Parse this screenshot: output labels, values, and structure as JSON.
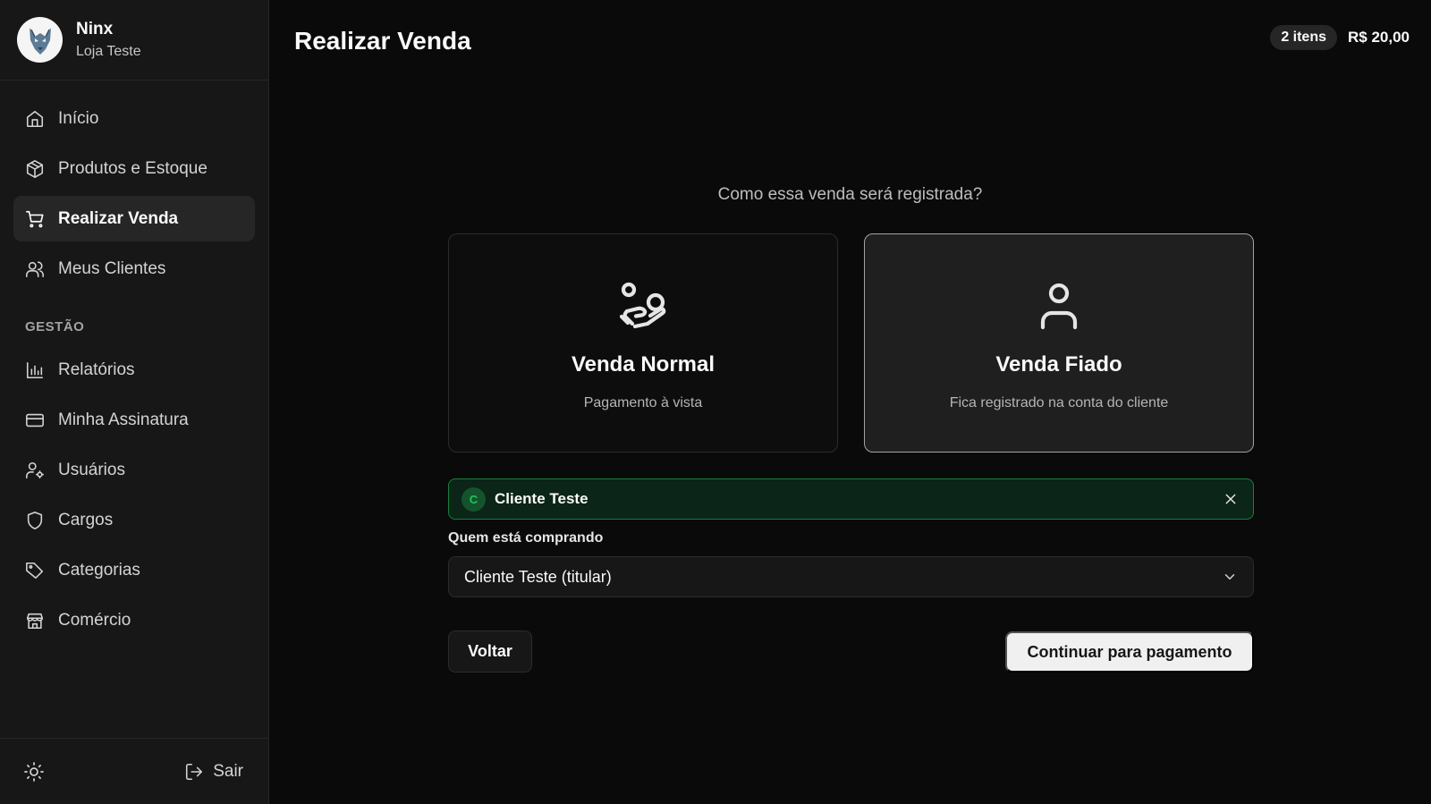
{
  "profile": {
    "name": "Ninx",
    "store": "Loja Teste"
  },
  "sidebar": {
    "items": [
      {
        "label": "Início",
        "icon": "home-icon"
      },
      {
        "label": "Produtos e Estoque",
        "icon": "package-icon"
      },
      {
        "label": "Realizar Venda",
        "icon": "cart-icon",
        "active": true
      },
      {
        "label": "Meus Clientes",
        "icon": "users-icon"
      }
    ],
    "section_label": "GESTÃO",
    "management_items": [
      {
        "label": "Relatórios",
        "icon": "bar-chart-icon"
      },
      {
        "label": "Minha Assinatura",
        "icon": "credit-card-icon"
      },
      {
        "label": "Usuários",
        "icon": "user-cog-icon"
      },
      {
        "label": "Cargos",
        "icon": "shield-icon"
      },
      {
        "label": "Categorias",
        "icon": "tag-icon"
      },
      {
        "label": "Comércio",
        "icon": "store-icon"
      }
    ],
    "footer": {
      "logout_label": "Sair",
      "theme_icon": "sun-icon"
    }
  },
  "header": {
    "title": "Realizar Venda",
    "cart_count": "2 itens",
    "cart_total": "R$ 20,00"
  },
  "main": {
    "question": "Como essa venda será registrada?",
    "options": [
      {
        "title": "Venda Normal",
        "subtitle": "Pagamento à vista",
        "icon": "hand-coins-icon",
        "selected": false
      },
      {
        "title": "Venda Fiado",
        "subtitle": "Fica registrado na conta do cliente",
        "icon": "user-icon",
        "selected": true
      }
    ],
    "selected_client": {
      "initial": "C",
      "name": "Cliente Teste"
    },
    "buyer": {
      "label": "Quem está comprando",
      "value": "Cliente Teste (titular)"
    },
    "back_label": "Voltar",
    "continue_label": "Continuar para pagamento"
  },
  "colors": {
    "background": "#0a0a0a",
    "sidebar": "#171717",
    "accent_green": "#15803d",
    "primary_button": "#f0f0f0"
  }
}
